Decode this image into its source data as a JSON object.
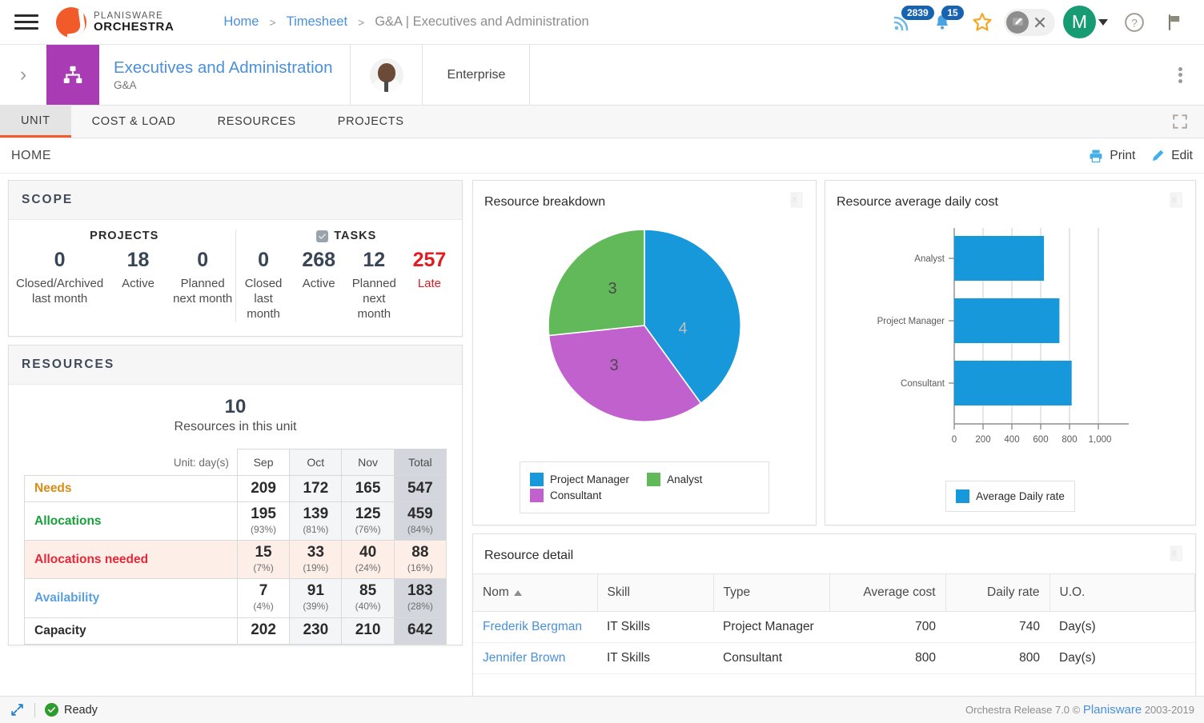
{
  "header": {
    "logo_line1": "PLANISWARE",
    "logo_line2": "ORCHESTRA",
    "breadcrumb": [
      {
        "label": "Home",
        "type": "link"
      },
      {
        "label": ">",
        "type": "sep"
      },
      {
        "label": "Timesheet",
        "type": "link"
      },
      {
        "label": ">",
        "type": "sep"
      },
      {
        "label": "G&A | Executives and Administration",
        "type": "current"
      }
    ],
    "feed_badge": "2839",
    "bell_badge": "15",
    "avatar_initial": "M"
  },
  "unit": {
    "title": "Executives and Administration",
    "subtitle": "G&A",
    "enterprise_label": "Enterprise"
  },
  "tabs": [
    {
      "label": "UNIT",
      "active": true
    },
    {
      "label": "COST & LOAD",
      "active": false
    },
    {
      "label": "RESOURCES",
      "active": false
    },
    {
      "label": "PROJECTS",
      "active": false
    }
  ],
  "homebar": {
    "title": "HOME",
    "print_label": "Print",
    "edit_label": "Edit"
  },
  "scope": {
    "section_title": "SCOPE",
    "projects": {
      "group_title": "PROJECTS",
      "cells": [
        {
          "value": "0",
          "caption": "Closed/Archived last month",
          "late": false
        },
        {
          "value": "18",
          "caption": "Active",
          "late": false
        },
        {
          "value": "0",
          "caption": "Planned next month",
          "late": false
        }
      ]
    },
    "tasks": {
      "group_title": "TASKS",
      "cells": [
        {
          "value": "0",
          "caption": "Closed last month",
          "late": false
        },
        {
          "value": "268",
          "caption": "Active",
          "late": false
        },
        {
          "value": "12",
          "caption": "Planned next month",
          "late": false
        },
        {
          "value": "257",
          "caption": "Late",
          "late": true
        }
      ]
    }
  },
  "resources": {
    "section_title": "RESOURCES",
    "count": "10",
    "count_caption": "Resources in this unit",
    "unit_label": "Unit: day(s)",
    "columns": [
      "Sep",
      "Oct",
      "Nov",
      "Total"
    ],
    "rows": [
      {
        "label": "Needs",
        "color": "c-needs",
        "highlight": false,
        "cells": [
          {
            "v": "209",
            "p": ""
          },
          {
            "v": "172",
            "p": ""
          },
          {
            "v": "165",
            "p": ""
          },
          {
            "v": "547",
            "p": ""
          }
        ]
      },
      {
        "label": "Allocations",
        "color": "c-alloc",
        "highlight": false,
        "cells": [
          {
            "v": "195",
            "p": "(93%)"
          },
          {
            "v": "139",
            "p": "(81%)"
          },
          {
            "v": "125",
            "p": "(76%)"
          },
          {
            "v": "459",
            "p": "(84%)"
          }
        ]
      },
      {
        "label": "Allocations needed",
        "color": "c-allocn",
        "highlight": true,
        "cells": [
          {
            "v": "15",
            "p": "(7%)"
          },
          {
            "v": "33",
            "p": "(19%)"
          },
          {
            "v": "40",
            "p": "(24%)"
          },
          {
            "v": "88",
            "p": "(16%)"
          }
        ]
      },
      {
        "label": "Availability",
        "color": "c-avail",
        "highlight": false,
        "cells": [
          {
            "v": "7",
            "p": "(4%)"
          },
          {
            "v": "91",
            "p": "(39%)"
          },
          {
            "v": "85",
            "p": "(40%)"
          },
          {
            "v": "183",
            "p": "(28%)"
          }
        ]
      },
      {
        "label": "Capacity",
        "color": "c-cap",
        "highlight": false,
        "cells": [
          {
            "v": "202",
            "p": ""
          },
          {
            "v": "230",
            "p": ""
          },
          {
            "v": "210",
            "p": ""
          },
          {
            "v": "642",
            "p": ""
          }
        ]
      }
    ]
  },
  "panels": {
    "pie_title": "Resource breakdown",
    "bar_title": "Resource average daily cost",
    "detail_title": "Resource detail"
  },
  "detail": {
    "columns": [
      {
        "label": "Nom",
        "align": "left",
        "sorted": true
      },
      {
        "label": "Skill",
        "align": "left",
        "sorted": false
      },
      {
        "label": "Type",
        "align": "left",
        "sorted": false
      },
      {
        "label": "Average cost",
        "align": "right",
        "sorted": false
      },
      {
        "label": "Daily rate",
        "align": "right",
        "sorted": false
      },
      {
        "label": "U.O.",
        "align": "left",
        "sorted": false
      }
    ],
    "rows": [
      {
        "nom": "Frederik Bergman",
        "skill": "IT Skills",
        "type": "Project Manager",
        "average_cost": "700",
        "daily_rate": "740",
        "uo": "Day(s)"
      },
      {
        "nom": "Jennifer Brown",
        "skill": "IT Skills",
        "type": "Consultant",
        "average_cost": "800",
        "daily_rate": "800",
        "uo": "Day(s)"
      }
    ]
  },
  "footer": {
    "status": "Ready",
    "release": "Orchestra Release 7.0 © ",
    "brand": "Planisware",
    "years": " 2003-2019"
  },
  "chart_data": [
    {
      "type": "pie",
      "title": "Resource breakdown",
      "legend_position": "bottom",
      "categories": [
        "Project Manager",
        "Analyst",
        "Consultant"
      ],
      "values": [
        4,
        3,
        3
      ],
      "labels": [
        "4",
        "3",
        "3"
      ],
      "colors": [
        "#1798da",
        "#62b959",
        "#c161cd"
      ],
      "slice_order": [
        "Project Manager",
        "Consultant",
        "Analyst"
      ],
      "start_angle_deg": 0,
      "total": 10
    },
    {
      "type": "bar",
      "orientation": "horizontal",
      "title": "Resource average daily cost",
      "categories": [
        "Analyst",
        "Project Manager",
        "Consultant"
      ],
      "values": [
        623,
        730,
        815
      ],
      "series": [
        {
          "name": "Average Daily rate",
          "values": [
            623,
            730,
            815
          ]
        }
      ],
      "xlabel": "",
      "ylabel": "",
      "xlim": [
        0,
        1000
      ],
      "xticks": [
        "0",
        "200",
        "400",
        "600",
        "800",
        "1,000"
      ],
      "xtick_values": [
        0,
        200,
        400,
        600,
        800,
        1000
      ],
      "grid": true,
      "legend_position": "bottom",
      "colors": [
        "#1798da"
      ]
    }
  ]
}
